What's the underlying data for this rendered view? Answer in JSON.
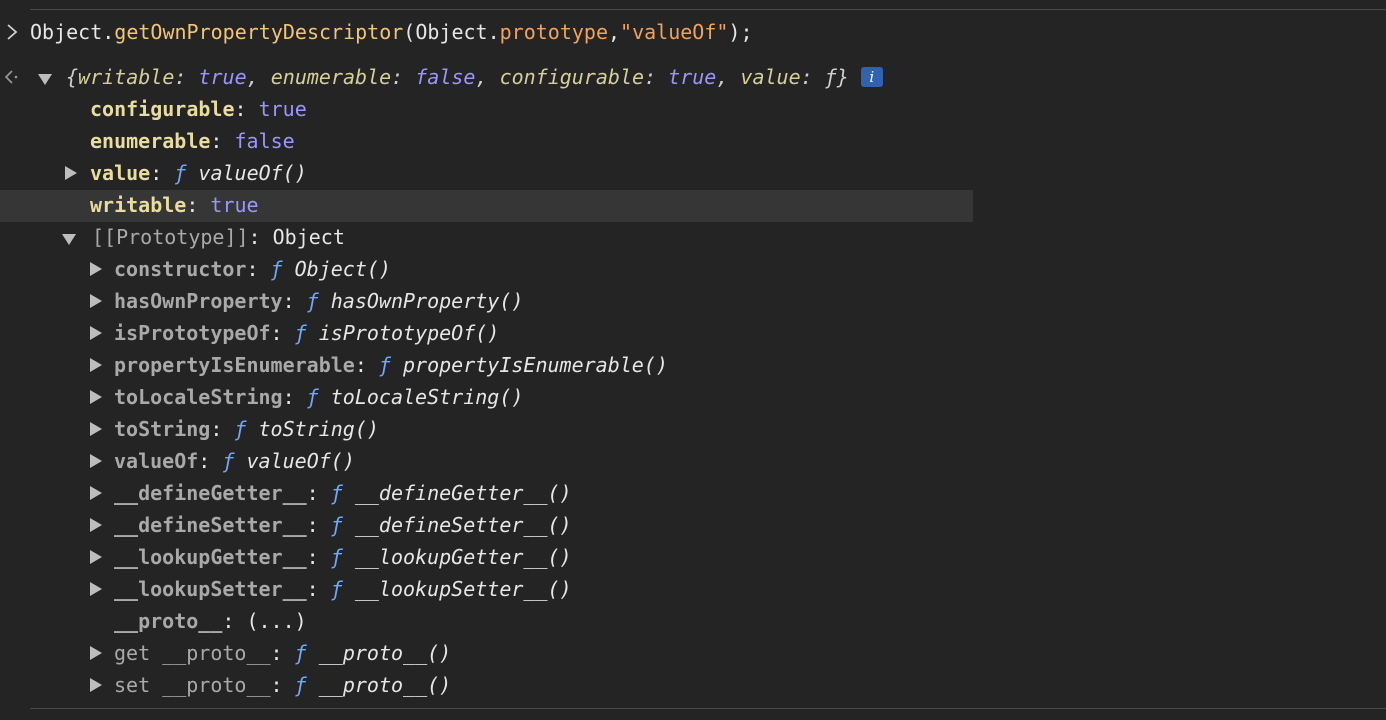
{
  "input": {
    "object": "Object",
    "dot1": ".",
    "method": "getOwnPropertyDescriptor",
    "open": "(",
    "arg_object": "Object",
    "dot2": ".",
    "arg_prop": "prototype",
    "comma": ",",
    "string": "\"valueOf\"",
    "close": ");"
  },
  "summary": {
    "open": "{",
    "writable_key": "writable",
    "writable_val": "true",
    "enumerable_key": "enumerable",
    "enumerable_val": "false",
    "configurable_key": "configurable",
    "configurable_val": "true",
    "value_key": "value",
    "value_val": "ƒ",
    "close": "}",
    "sep": ": ",
    "comma": ", ",
    "info_badge": "i"
  },
  "descriptor": {
    "configurable": {
      "key": "configurable",
      "val": "true"
    },
    "enumerable": {
      "key": "enumerable",
      "val": "false"
    },
    "value": {
      "key": "value",
      "f": "ƒ",
      "val": "valueOf()"
    },
    "writable": {
      "key": "writable",
      "val": "true"
    }
  },
  "prototype": {
    "key": "[[Prototype]]",
    "val": "Object",
    "items": [
      {
        "key": "constructor",
        "f": "ƒ",
        "val": "Object()"
      },
      {
        "key": "hasOwnProperty",
        "f": "ƒ",
        "val": "hasOwnProperty()"
      },
      {
        "key": "isPrototypeOf",
        "f": "ƒ",
        "val": "isPrototypeOf()"
      },
      {
        "key": "propertyIsEnumerable",
        "f": "ƒ",
        "val": "propertyIsEnumerable()"
      },
      {
        "key": "toLocaleString",
        "f": "ƒ",
        "val": "toLocaleString()"
      },
      {
        "key": "toString",
        "f": "ƒ",
        "val": "toString()"
      },
      {
        "key": "valueOf",
        "f": "ƒ",
        "val": "valueOf()"
      },
      {
        "key": "__defineGetter__",
        "f": "ƒ",
        "val": "__defineGetter__()"
      },
      {
        "key": "__defineSetter__",
        "f": "ƒ",
        "val": "__defineSetter__()"
      },
      {
        "key": "__lookupGetter__",
        "f": "ƒ",
        "val": "__lookupGetter__()"
      },
      {
        "key": "__lookupSetter__",
        "f": "ƒ",
        "val": "__lookupSetter__()"
      },
      {
        "key": "__proto__",
        "val": "(...)"
      },
      {
        "key": "get __proto__",
        "f": "ƒ",
        "val": "__proto__()"
      },
      {
        "key": "set __proto__",
        "f": "ƒ",
        "val": "__proto__()"
      }
    ]
  },
  "colors": {
    "background": "#242424",
    "highlight_row": "#363636",
    "key": "#e8dd9f",
    "boolean": "#9d95ff",
    "function_f": "#6fa8ff",
    "string": "#f0a35a",
    "method": "#f0c674",
    "info_badge": "#2f63b2"
  }
}
